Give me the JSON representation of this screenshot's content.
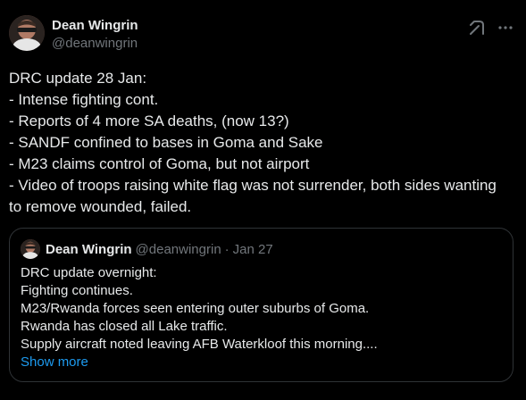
{
  "author": {
    "display_name": "Dean Wingrin",
    "handle": "@deanwingrin",
    "avatar_icon": "user-avatar-icon"
  },
  "header_actions": {
    "grok_icon": "grok-icon",
    "more_icon": "more-horizontal-icon"
  },
  "tweet": {
    "lines": [
      "DRC update 28 Jan:",
      "- Intense fighting cont.",
      "- Reports of 4 more SA deaths, (now 13?)",
      "- SANDF confined to bases in Goma and Sake",
      "- M23 claims control of Goma, but not airport",
      "- Video of troops raising white flag was not surrender, both sides wanting",
      "to remove wounded, failed."
    ]
  },
  "quote": {
    "display_name": "Dean Wingrin",
    "handle": "@deanwingrin",
    "separator": "·",
    "date": "Jan 27",
    "lines": [
      "DRC update overnight:",
      "Fighting continues.",
      "M23/Rwanda forces seen entering outer suburbs of Goma.",
      "Rwanda has closed all Lake traffic.",
      "Supply aircraft noted leaving AFB Waterkloof this morning...."
    ],
    "show_more_label": "Show more"
  },
  "colors": {
    "background": "#000000",
    "primary_text": "#e7e9ea",
    "secondary_text": "#71767b",
    "link": "#1d9bf0",
    "border": "#2f3336"
  }
}
